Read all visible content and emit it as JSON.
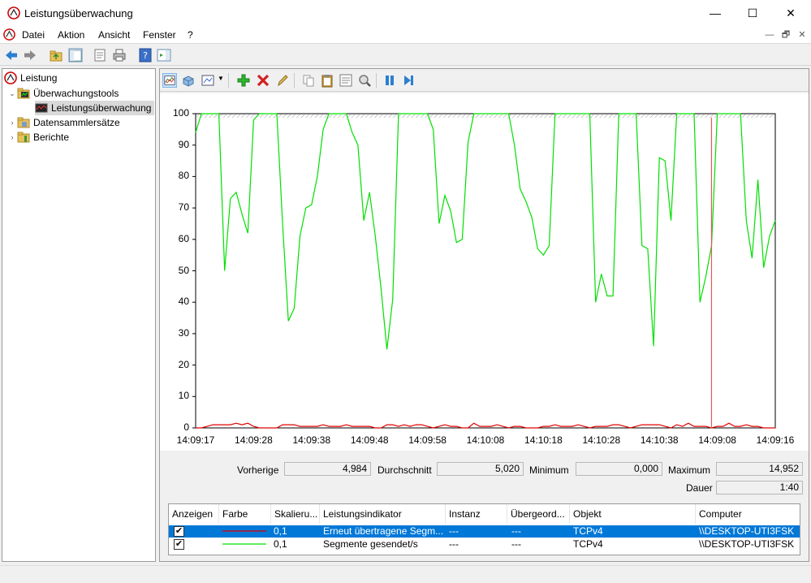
{
  "window": {
    "title": "Leistungsüberwachung",
    "minimize": "—",
    "maximize": "☐",
    "close": "✕"
  },
  "menu": {
    "items": [
      "Datei",
      "Aktion",
      "Ansicht",
      "Fenster",
      "?"
    ],
    "mdi": [
      "—",
      "🗗",
      "✕"
    ]
  },
  "tree": {
    "root": "Leistung",
    "tools": "Überwachungstools",
    "monitor": "Leistungsüberwachung",
    "collectors": "Datensammlersätze",
    "reports": "Berichte"
  },
  "colors": {
    "accent": "#0078d7",
    "series_red": "#e00000",
    "series_green": "#00e000",
    "redline": "#e05a5a"
  },
  "chart_data": {
    "type": "line",
    "ylim": [
      0,
      100
    ],
    "yticks": [
      "0",
      "10",
      "20",
      "30",
      "40",
      "50",
      "60",
      "70",
      "80",
      "90",
      "100"
    ],
    "xticks": [
      "14:09:17",
      "14:09:28",
      "14:09:38",
      "14:09:48",
      "14:09:58",
      "14:10:08",
      "14:10:18",
      "14:10:28",
      "14:10:38",
      "14:09:08",
      "14:09:16"
    ],
    "current_sample_index": 89,
    "series": [
      {
        "name": "Erneut übertragene Segmente/s",
        "color": "#e00000",
        "values": [
          0,
          0,
          0.5,
          1,
          1,
          1,
          1,
          1.5,
          1,
          1.5,
          0.5,
          0,
          0,
          0,
          0,
          1,
          1,
          1,
          0.5,
          0.5,
          0.5,
          0.5,
          1,
          0.5,
          0.5,
          0.5,
          1,
          0.5,
          0.5,
          0.5,
          0.5,
          0,
          0,
          1,
          1,
          0.5,
          1,
          0.5,
          1,
          1,
          0.5,
          0,
          0.5,
          1,
          0.5,
          0.5,
          0,
          0,
          1.5,
          0.5,
          0.5,
          0.5,
          1,
          0.5,
          0,
          0.5,
          0.5,
          0,
          0,
          0,
          0.5,
          0.5,
          1,
          0.5,
          0.5,
          0.5,
          1,
          0.5,
          0,
          0.5,
          0.5,
          0.5,
          1,
          1,
          0.5,
          0,
          0.5,
          1,
          1,
          1,
          1,
          0.5,
          0,
          1,
          0.5,
          1.5,
          0.5,
          0.5,
          0.5,
          0,
          0.5,
          0.5,
          1.5,
          0.5,
          0.5,
          1,
          0.5,
          0.5,
          0,
          0,
          0
        ]
      },
      {
        "name": "Segmente gesendet/s",
        "color": "#00e000",
        "values": [
          94,
          100,
          100,
          100,
          100,
          50,
          73,
          75,
          68,
          62,
          98,
          100,
          100,
          100,
          100,
          65,
          34,
          38,
          61,
          70,
          71,
          80,
          95,
          100,
          100,
          100,
          100,
          94,
          90,
          66,
          75,
          61,
          44,
          25,
          41,
          100,
          100,
          100,
          100,
          100,
          100,
          95,
          65,
          74,
          69,
          59,
          60,
          91,
          100,
          100,
          100,
          100,
          100,
          100,
          100,
          90,
          76,
          72,
          67,
          57,
          55,
          58,
          100,
          100,
          100,
          100,
          100,
          100,
          100,
          40,
          49,
          42,
          42,
          100,
          100,
          100,
          100,
          58,
          57,
          26,
          86,
          85,
          66,
          100,
          100,
          100,
          100,
          40,
          48,
          58,
          100,
          100,
          100,
          100,
          100,
          66,
          54,
          79,
          51,
          61,
          66
        ]
      }
    ]
  },
  "stats": {
    "prev_label": "Vorherige",
    "prev_value": "4,984",
    "avg_label": "Durchschnitt",
    "avg_value": "5,020",
    "min_label": "Minimum",
    "min_value": "0,000",
    "max_label": "Maximum",
    "max_value": "14,952",
    "dur_label": "Dauer",
    "dur_value": "1:40"
  },
  "grid": {
    "headers": [
      "Anzeigen",
      "Farbe",
      "Skalieru...",
      "Leistungsindikator",
      "Instanz",
      "Übergeord...",
      "Objekt",
      "Computer"
    ],
    "rows": [
      {
        "show": "✔",
        "scale": "0,1",
        "counter": "Erneut übertragene Segm...",
        "instance": "---",
        "parent": "---",
        "object": "TCPv4",
        "computer": "\\\\DESKTOP-UTI3FSK",
        "color": "#e00000"
      },
      {
        "show": "✔",
        "scale": "0,1",
        "counter": "Segmente gesendet/s",
        "instance": "---",
        "parent": "---",
        "object": "TCPv4",
        "computer": "\\\\DESKTOP-UTI3FSK",
        "color": "#00e000"
      }
    ]
  }
}
